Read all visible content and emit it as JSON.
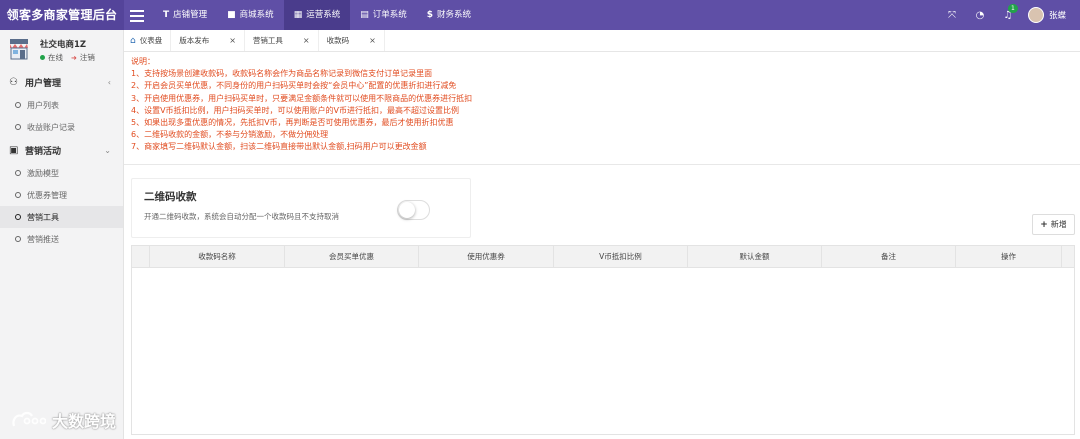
{
  "app": {
    "title": "领客多商家管理后台"
  },
  "topnav": [
    {
      "label": "店铺管理",
      "icon": "T"
    },
    {
      "label": "商城系统",
      "icon": "■"
    },
    {
      "label": "运营系统",
      "icon": "▦"
    },
    {
      "label": "订单系统",
      "icon": "▤"
    },
    {
      "label": "财务系统",
      "icon": "$"
    }
  ],
  "topnav_active": "运营系统",
  "top_right": {
    "notification_count": "1",
    "user_name": "张蝶"
  },
  "sidebar": {
    "shop_name": "社交电商1Z",
    "status": "在线",
    "logout": "注销",
    "groups": [
      {
        "label": "用户管理",
        "items": [
          "用户列表",
          "收益账户记录"
        ]
      },
      {
        "label": "营销活动",
        "items": [
          "激励模型",
          "优惠券管理",
          "营销工具",
          "营销推送"
        ]
      }
    ],
    "active_item": "营销工具"
  },
  "watermark": "大数跨境",
  "tabs": [
    {
      "label": "仪表盘"
    },
    {
      "label": "版本发布"
    },
    {
      "label": "营销工具"
    },
    {
      "label": "收款码"
    }
  ],
  "notes": {
    "heading": "说明：",
    "lines": [
      "1、支持按场景创建收款码，收款码名称会作为商品名称记录到微信支付订单记录里面",
      "2、开启会员买单优惠，不同身份的用户扫码买单时会按“会员中心”配置的优惠折扣进行减免",
      "3、开启使用优惠券，用户扫码买单时，只要满足金额条件就可以使用不限商品的优惠券进行抵扣",
      "4、设置V币抵扣比例，用户扫码买单时，可以使用账户的V币进行抵扣，最高不超过设置比例",
      "5、如果出现多重优惠的情况，先抵扣V币，再判断是否可使用优惠券，最后才使用折扣优惠",
      "6、二维码收款的金额，不参与分销激励，不做分佣处理",
      "7、商家填写二维码默认金额，扫该二维码直接带出默认金额,扫码用户可以更改金额"
    ]
  },
  "qr": {
    "title": "二维码收款",
    "description": "开通二维码收款，系统会自动分配一个收款码且不支持取消",
    "enabled": false
  },
  "add_button": "新增",
  "table": {
    "columns": [
      "",
      "收款码名称",
      "会员买单优惠",
      "使用优惠券",
      "V币抵扣比例",
      "默认金额",
      "备注",
      "操作"
    ],
    "rows": []
  },
  "colors": {
    "header": "#5f4fa6",
    "brand": "#54449a",
    "notes": "#e14b1f",
    "online": "#22a34a"
  }
}
